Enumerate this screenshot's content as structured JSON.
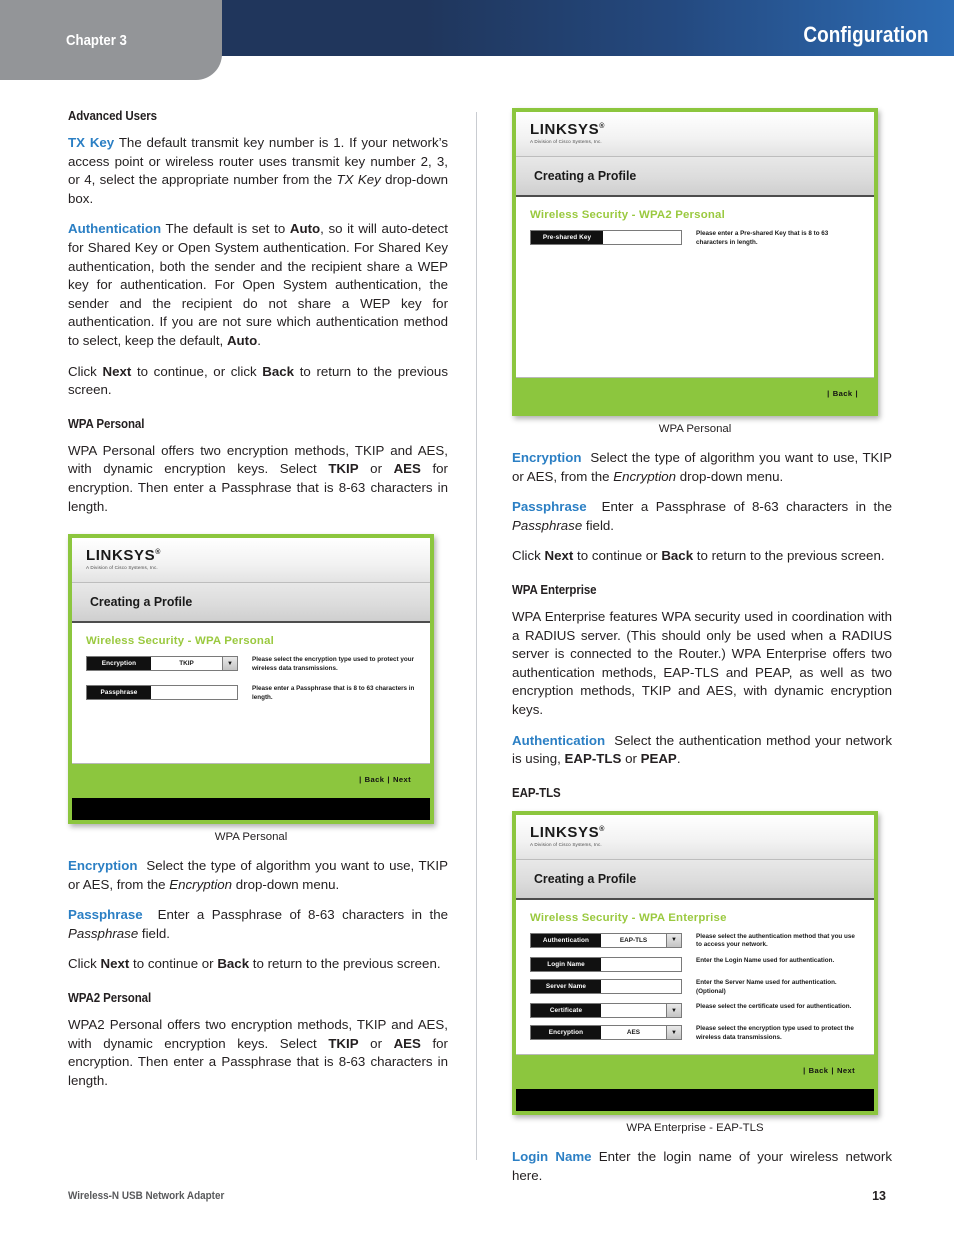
{
  "header": {
    "chapter": "Chapter 3",
    "title": "Configuration",
    "colors": {
      "tab_gray": "#939598",
      "band_navy": "#20365c",
      "band_blue": "#2d6cb4",
      "link_blue": "#2b7fc4",
      "linksys_green": "#8cc63e"
    }
  },
  "left_column": {
    "heading_advanced_users": "Advanced Users",
    "para_tx_key": {
      "term": "TX Key",
      "text_1": "The default transmit key number is 1. If your network’s access point or wireless router uses transmit key number 2, 3, or 4, select the appropriate number from the ",
      "italic_1": "TX Key",
      "text_2": " drop-down box."
    },
    "para_authentication": {
      "term": "Authentication",
      "text_1": "The default is set to ",
      "bold_1": "Auto",
      "text_2": ", so it will auto-detect for Shared Key or Open System authentication. For Shared Key authentication, both the sender and the recipient share a WEP key for authentication. For Open System authentication, the sender and the recipient do not share a WEP key for authentication. If you are not sure which authentication method to select, keep the default, ",
      "bold_2": "Auto",
      "text_3": "."
    },
    "para_click_next": {
      "text_1": "Click ",
      "bold_1": "Next",
      "text_2": " to continue, or click ",
      "bold_2": "Back",
      "text_3": " to return to the previous screen."
    },
    "heading_wpa_personal": "WPA Personal",
    "para_wpa_personal": {
      "text_1": "WPA Personal offers two encryption methods, TKIP and AES, with dynamic encryption keys. Select ",
      "bold_1": "TKIP",
      "text_2": " or ",
      "bold_2": "AES",
      "text_3": " for encryption. Then enter a Passphrase that is 8-63 characters in length."
    },
    "figure_caption": "WPA Personal",
    "para_encryption": {
      "term": "Encryption",
      "text_1": "Select the type of algorithm you want to use, TKIP or AES, from the ",
      "italic_1": "Encryption",
      "text_2": " drop-down menu."
    },
    "para_passphrase": {
      "term": "Passphrase",
      "text_1": "Enter a Passphrase of 8-63 characters in the ",
      "italic_1": "Passphrase",
      "text_2": " field."
    },
    "para_click_next_2": {
      "text_1": "Click ",
      "bold_1": "Next",
      "text_2": " to continue or ",
      "bold_2": "Back",
      "text_3": " to return to the previous screen."
    },
    "heading_wpa2_personal": "WPA2 Personal",
    "para_wpa2_personal": {
      "text_1": "WPA2 Personal offers two encryption methods, TKIP and AES, with dynamic encryption keys. Select ",
      "bold_1": "TKIP",
      "text_2": " or ",
      "bold_2": "AES",
      "text_3": " for encryption. Then enter a Passphrase that is 8-63 characters in length."
    }
  },
  "right_column": {
    "figure_caption_1": "WPA Personal",
    "para_encryption": {
      "term": "Encryption",
      "text_1": "Select the type of algorithm you want to use, TKIP or AES, from the ",
      "italic_1": "Encryption",
      "text_2": " drop-down menu."
    },
    "para_passphrase": {
      "term": "Passphrase",
      "text_1": "Enter a Passphrase of 8-63 characters in the ",
      "italic_1": "Passphrase",
      "text_2": " field."
    },
    "para_click_next": {
      "text_1": "Click ",
      "bold_1": "Next",
      "text_2": " to continue or ",
      "bold_2": "Back",
      "text_3": " to return to the previous screen."
    },
    "heading_wpa_enterprise": "WPA Enterprise",
    "para_wpa_enterprise": "WPA Enterprise features WPA security used in coordination with a RADIUS server. (This should only be used when a RADIUS server is connected to the Router.) WPA Enterprise offers two authentication methods, EAP-TLS and PEAP, as well as two encryption methods, TKIP and AES, with dynamic encryption keys.",
    "para_authentication": {
      "term": "Authentication",
      "text_1": "Select the authentication method your network is using, ",
      "bold_1": "EAP-TLS",
      "text_2": " or ",
      "bold_2": "PEAP",
      "text_3": "."
    },
    "heading_eap_tls": "EAP-TLS",
    "figure_caption_2": "WPA Enterprise - EAP-TLS",
    "para_login_name": {
      "term": "Login Name",
      "text_1": "Enter the login name of your wireless network here."
    }
  },
  "dialog_wpa_personal": {
    "logo": "LINKSYS",
    "logo_trademark": "®",
    "logo_sub": "A Division of Cisco Systems, Inc.",
    "titlebar": "Creating a Profile",
    "section_title": "Wireless Security - WPA Personal",
    "fields": [
      {
        "label": "Encryption",
        "value": "TKIP",
        "control": "dropdown",
        "help": "Please select the encryption type used to protect your wireless data transmissions."
      },
      {
        "label": "Passphrase",
        "value": "",
        "control": "text",
        "help": "Please enter a Passphrase that is 8 to 63 characters in length."
      }
    ],
    "buttons": [
      "Back",
      "Next"
    ]
  },
  "dialog_wpa2_personal": {
    "logo": "LINKSYS",
    "logo_trademark": "®",
    "logo_sub": "A Division of Cisco Systems, Inc.",
    "titlebar": "Creating a Profile",
    "section_title": "Wireless Security - WPA2 Personal",
    "fields": [
      {
        "label": "Pre-shared Key",
        "value": "",
        "control": "text",
        "help": "Please enter a Pre-shared Key that is 8 to 63 characters in length."
      }
    ],
    "buttons": [
      "Back"
    ]
  },
  "dialog_wpa_enterprise": {
    "logo": "LINKSYS",
    "logo_trademark": "®",
    "logo_sub": "A Division of Cisco Systems, Inc.",
    "titlebar": "Creating a Profile",
    "section_title": "Wireless Security - WPA Enterprise",
    "fields": [
      {
        "label": "Authentication",
        "value": "EAP-TLS",
        "control": "dropdown",
        "help": "Please select the authentication method that you use to access your network."
      },
      {
        "label": "Login Name",
        "value": "",
        "control": "text",
        "help": "Enter the Login Name used for authentication."
      },
      {
        "label": "Server Name",
        "value": "",
        "control": "text",
        "help": "Enter the Server Name used for authentication. (Optional)"
      },
      {
        "label": "Certificate",
        "value": "",
        "control": "dropdown",
        "help": "Please select the certificate used for authentication."
      },
      {
        "label": "Encryption",
        "value": "AES",
        "control": "dropdown",
        "help": "Please select the encryption type used to protect the wireless data transmissions."
      }
    ],
    "buttons": [
      "Back",
      "Next"
    ]
  },
  "footer": {
    "product": "Wireless-N USB Network Adapter",
    "page_number": "13"
  }
}
